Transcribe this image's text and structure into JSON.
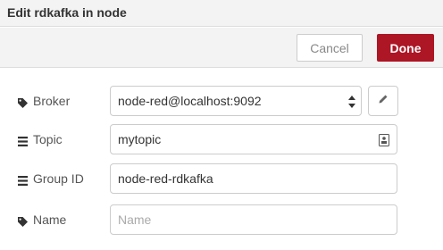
{
  "dialog": {
    "title": "Edit rdkafka in node"
  },
  "toolbar": {
    "cancel_label": "Cancel",
    "done_label": "Done"
  },
  "colors": {
    "done_bg": "#ad1625",
    "toolbar_bg": "#f3f3f3",
    "border": "#cccccc"
  },
  "form": {
    "broker": {
      "label": "Broker",
      "icon": "tag-icon",
      "value": "node-red@localhost:9092"
    },
    "topic": {
      "label": "Topic",
      "icon": "list-icon",
      "value": "mytopic"
    },
    "group_id": {
      "label": "Group ID",
      "icon": "list-icon",
      "value": "node-red-rdkafka"
    },
    "name": {
      "label": "Name",
      "icon": "tag-icon",
      "value": "",
      "placeholder": "Name"
    }
  }
}
